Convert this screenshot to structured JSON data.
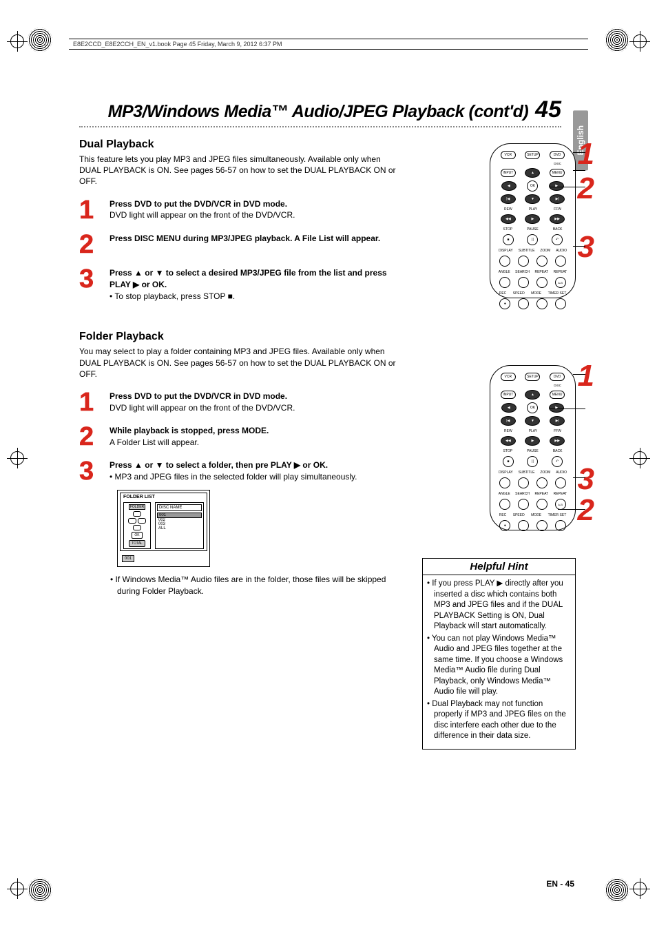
{
  "header_line": "E8E2CCD_E8E2CCH_EN_v1.book  Page 45  Friday, March 9, 2012  6:37 PM",
  "page_title": "MP3/Windows Media™ Audio/JPEG Playback (cont'd)",
  "page_number": "45",
  "lang_tab": "English",
  "footer": "EN - 45",
  "dual": {
    "heading": "Dual Playback",
    "intro": "This feature lets you play MP3 and JPEG files simultaneously. Available only when DUAL PLAYBACK is ON. See pages 56-57 on how to set the DUAL PLAYBACK ON or OFF.",
    "s1n": "1",
    "s1a": "Press DVD to put the DVD/VCR in DVD mode.",
    "s1b": "DVD light will appear on the front of the DVD/VCR.",
    "s2n": "2",
    "s2a": "Press DISC MENU during MP3/JPEG playback. A File List will appear.",
    "s3n": "3",
    "s3a": "Press ▲ or ▼ to select a desired MP3/JPEG file from the list and press PLAY ▶ or OK.",
    "s3b": "• To stop playback, press STOP ■."
  },
  "folder": {
    "heading": "Folder Playback",
    "intro": "You may select to play a folder containing MP3 and JPEG files. Available only when DUAL PLAYBACK is ON. See pages 56-57 on how to set the DUAL PLAYBACK ON or OFF.",
    "s1n": "1",
    "s1a": "Press DVD to put the DVD/VCR in DVD mode.",
    "s1b": "DVD light will appear on the front of the DVD/VCR.",
    "s2n": "2",
    "s2a": "While playback is stopped, press MODE.",
    "s2b": "A Folder List will appear.",
    "s3n": "3",
    "s3a": "Press ▲ or ▼ to select a folder, then pre PLAY ▶ or OK.",
    "s3b": "• MP3 and JPEG files in the selected folder will play simultaneously.",
    "note": "• If Windows Media™ Audio files are in the folder, those files will be skipped during Folder Playback."
  },
  "folder_list": {
    "title": "FOLDER LIST",
    "left_label": "FOLDER",
    "ok": "OK",
    "total": "TOTAL",
    "disc_name": "DISC NAME",
    "items": [
      "001",
      "002",
      "003",
      "ALL"
    ],
    "bottom": "001"
  },
  "remote": {
    "vcr": "VCR",
    "setup": "SETUP",
    "dvd": "DVD",
    "disc": "DISC",
    "input": "INPUT",
    "menu": "MENU",
    "ok": "OK",
    "rew": "REW",
    "play": "PLAY",
    "ffw": "FFW",
    "stop": "STOP",
    "pause": "PAUSE",
    "back": "BACK",
    "display": "DISPLAY",
    "subtitle": "SUBTITLE",
    "zoom": "ZOOM",
    "audio": "AUDIO",
    "angle": "ANGLE",
    "search": "SEARCH",
    "repeat": "REPEAT",
    "repeat2": "REPEAT",
    "ab": "A-B",
    "rec": "REC",
    "speed": "SPEED",
    "mode": "MODE",
    "timerset": "TIMER SET",
    "c1": "1",
    "c2": "2",
    "c3": "3"
  },
  "hint": {
    "title": "Helpful Hint",
    "i1": "If you press PLAY ▶ directly after you inserted a disc which contains both MP3 and JPEG files and if the DUAL PLAYBACK Setting is ON, Dual Playback will start automatically.",
    "i2": "You can not play Windows Media™ Audio and JPEG files together at the same time. If you choose a Windows Media™ Audio file during Dual Playback, only Windows Media™ Audio file will play.",
    "i3": "Dual Playback may not function properly if MP3 and JPEG files on the disc interfere each other due to the difference in their data size."
  }
}
